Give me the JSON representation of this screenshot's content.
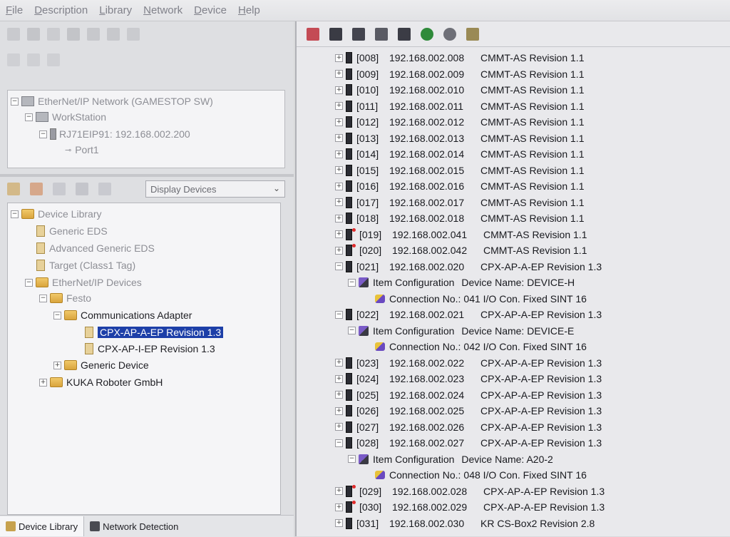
{
  "menu": [
    "File",
    "Description",
    "Library",
    "Network",
    "Device",
    "Help"
  ],
  "network_tree": {
    "root": "EtherNet/IP Network (GAMESTOP SW)",
    "workstation": "WorkStation",
    "module": "RJ71EIP91: 192.168.002.200",
    "port": "Port1"
  },
  "display_select": "Display Devices",
  "library_tree": {
    "root": "Device Library",
    "generic_eds": "Generic EDS",
    "advanced_generic_eds": "Advanced Generic EDS",
    "target": "Target (Class1 Tag)",
    "ethernet_devices": "EtherNet/IP Devices",
    "festo": "Festo",
    "comm_adapter": "Communications Adapter",
    "selected_item": "CPX-AP-A-EP Revision 1.3",
    "item2": "CPX-AP-I-EP Revision 1.3",
    "generic_device": "Generic Device",
    "kuka": "KUKA Roboter GmbH"
  },
  "bottom_tabs": [
    "Device Library",
    "Network Detection"
  ],
  "devices": [
    {
      "kind": "device",
      "id": "[008]",
      "ip": "192.168.002.008",
      "name": "CMMT-AS Revision 1.1",
      "alert": false
    },
    {
      "kind": "device",
      "id": "[009]",
      "ip": "192.168.002.009",
      "name": "CMMT-AS Revision 1.1",
      "alert": false
    },
    {
      "kind": "device",
      "id": "[010]",
      "ip": "192.168.002.010",
      "name": "CMMT-AS Revision 1.1",
      "alert": false
    },
    {
      "kind": "device",
      "id": "[011]",
      "ip": "192.168.002.011",
      "name": "CMMT-AS Revision 1.1",
      "alert": false
    },
    {
      "kind": "device",
      "id": "[012]",
      "ip": "192.168.002.012",
      "name": "CMMT-AS Revision 1.1",
      "alert": false
    },
    {
      "kind": "device",
      "id": "[013]",
      "ip": "192.168.002.013",
      "name": "CMMT-AS Revision 1.1",
      "alert": false
    },
    {
      "kind": "device",
      "id": "[014]",
      "ip": "192.168.002.014",
      "name": "CMMT-AS Revision 1.1",
      "alert": false
    },
    {
      "kind": "device",
      "id": "[015]",
      "ip": "192.168.002.015",
      "name": "CMMT-AS Revision 1.1",
      "alert": false
    },
    {
      "kind": "device",
      "id": "[016]",
      "ip": "192.168.002.016",
      "name": "CMMT-AS Revision 1.1",
      "alert": false
    },
    {
      "kind": "device",
      "id": "[017]",
      "ip": "192.168.002.017",
      "name": "CMMT-AS Revision 1.1",
      "alert": false
    },
    {
      "kind": "device",
      "id": "[018]",
      "ip": "192.168.002.018",
      "name": "CMMT-AS Revision 1.1",
      "alert": false
    },
    {
      "kind": "device",
      "id": "[019]",
      "ip": "192.168.002.041",
      "name": "CMMT-AS Revision 1.1",
      "alert": true
    },
    {
      "kind": "device",
      "id": "[020]",
      "ip": "192.168.002.042",
      "name": "CMMT-AS Revision 1.1",
      "alert": true
    },
    {
      "kind": "device",
      "id": "[021]",
      "ip": "192.168.002.020",
      "name": "CPX-AP-A-EP Revision 1.3",
      "alert": false,
      "expanded": true
    },
    {
      "kind": "config",
      "label": "Item Configuration",
      "value": "Device Name: DEVICE-H"
    },
    {
      "kind": "conn",
      "label": "Connection No.:",
      "value": "041 I/O Con. Fixed SINT 16"
    },
    {
      "kind": "device",
      "id": "[022]",
      "ip": "192.168.002.021",
      "name": "CPX-AP-A-EP Revision 1.3",
      "alert": false,
      "expanded": true
    },
    {
      "kind": "config",
      "label": "Item Configuration",
      "value": "Device Name: DEVICE-E"
    },
    {
      "kind": "conn",
      "label": "Connection No.:",
      "value": "042 I/O Con. Fixed SINT 16"
    },
    {
      "kind": "device",
      "id": "[023]",
      "ip": "192.168.002.022",
      "name": "CPX-AP-A-EP Revision 1.3",
      "alert": false
    },
    {
      "kind": "device",
      "id": "[024]",
      "ip": "192.168.002.023",
      "name": "CPX-AP-A-EP Revision 1.3",
      "alert": false
    },
    {
      "kind": "device",
      "id": "[025]",
      "ip": "192.168.002.024",
      "name": "CPX-AP-A-EP Revision 1.3",
      "alert": false
    },
    {
      "kind": "device",
      "id": "[026]",
      "ip": "192.168.002.025",
      "name": "CPX-AP-A-EP Revision 1.3",
      "alert": false
    },
    {
      "kind": "device",
      "id": "[027]",
      "ip": "192.168.002.026",
      "name": "CPX-AP-A-EP Revision 1.3",
      "alert": false
    },
    {
      "kind": "device",
      "id": "[028]",
      "ip": "192.168.002.027",
      "name": "CPX-AP-A-EP Revision 1.3",
      "alert": false,
      "expanded": true
    },
    {
      "kind": "config",
      "label": "Item Configuration",
      "value": "Device Name: A20-2"
    },
    {
      "kind": "conn",
      "label": "Connection No.:",
      "value": "048 I/O Con. Fixed SINT 16"
    },
    {
      "kind": "device",
      "id": "[029]",
      "ip": "192.168.002.028",
      "name": "CPX-AP-A-EP Revision 1.3",
      "alert": true
    },
    {
      "kind": "device",
      "id": "[030]",
      "ip": "192.168.002.029",
      "name": "CPX-AP-A-EP Revision 1.3",
      "alert": true
    },
    {
      "kind": "device",
      "id": "[031]",
      "ip": "192.168.002.030",
      "name": "KR CS-Box2 Revision 2.8",
      "alert": false
    }
  ]
}
